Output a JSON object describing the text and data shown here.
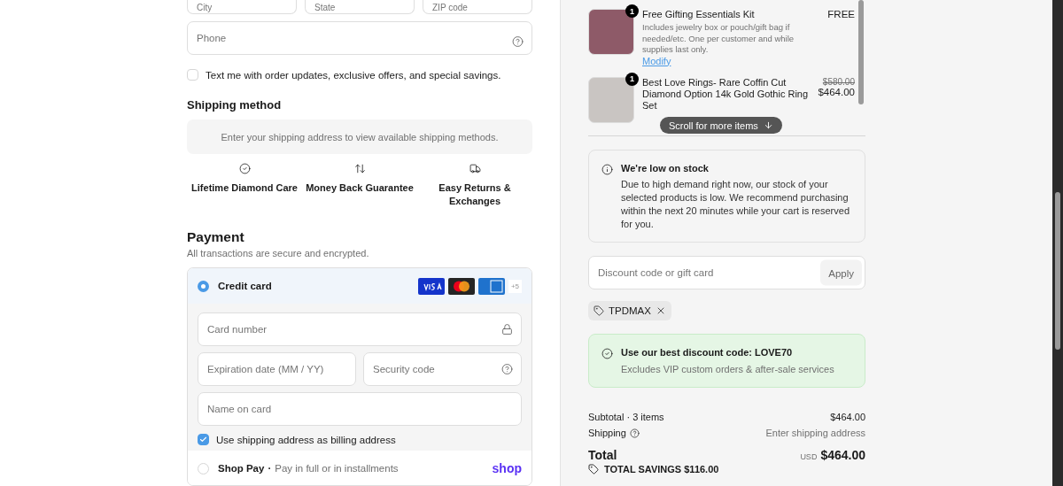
{
  "address_fields": [
    {
      "placeholder": "City"
    },
    {
      "placeholder": "State"
    },
    {
      "placeholder": "ZIP code"
    }
  ],
  "phone": {
    "placeholder": "Phone"
  },
  "sms_opt_in": {
    "label": "Text me with order updates, exclusive offers, and special savings.",
    "checked": false
  },
  "shipping_method": {
    "title": "Shipping method",
    "notice": "Enter your shipping address to view available shipping methods."
  },
  "perks": [
    {
      "kind": "care",
      "label": "Lifetime Diamond Care"
    },
    {
      "kind": "money",
      "label": "Money Back Guarantee"
    },
    {
      "kind": "returns",
      "label": "Easy Returns & Exchanges"
    }
  ],
  "payment": {
    "title": "Payment",
    "subtitle": "All transactions are secure and encrypted.",
    "methods": [
      {
        "kind": "card",
        "label": "Credit card",
        "selected": true,
        "more_brands": "+5"
      },
      {
        "kind": "shop",
        "label": "Shop Pay",
        "separator": "·",
        "detail": "Pay in full or in installments",
        "brand": "shop",
        "selected": false
      }
    ],
    "card_fields": {
      "number": {
        "placeholder": "Card number"
      },
      "expiry": {
        "placeholder": "Expiration date (MM / YY)"
      },
      "cvv": {
        "placeholder": "Security code"
      },
      "name": {
        "placeholder": "Name on card"
      }
    },
    "billing_same": {
      "label": "Use shipping address as billing address",
      "checked": true
    }
  },
  "cart_items": [
    {
      "quantity": "1",
      "name": "Free Gifting Essentials Kit",
      "description": "Includes jewelry box or pouch/gift bag if needed/etc. One per customer and while supplies last only.",
      "link": "Modify",
      "price": "FREE"
    },
    {
      "quantity": "1",
      "name": "Best Love Rings- Rare Coffin Cut Diamond Option 14k Gold Gothic Ring Set",
      "original_price": "$580.00",
      "price": "$464.00"
    }
  ],
  "scroll_hint": "Scroll for more items",
  "stock_alert": {
    "title": "We're low on stock",
    "body": "Due to high demand right now, our stock of your selected products is low. We recommend purchasing within the next 20 minutes while your cart is reserved for you."
  },
  "discount": {
    "placeholder": "Discount code or gift card",
    "button": "Apply",
    "applied": [
      {
        "code": "TPDMAX"
      }
    ]
  },
  "promo": {
    "title": "Use our best discount code: LOVE70",
    "body": "Excludes VIP custom orders & after-sale services"
  },
  "summary": {
    "subtotal_label": "Subtotal · 3 items",
    "subtotal": "$464.00",
    "shipping_label": "Shipping",
    "shipping": "Enter shipping address",
    "total_label": "Total",
    "currency": "USD",
    "total": "$464.00",
    "savings": "TOTAL SAVINGS  $116.00"
  }
}
